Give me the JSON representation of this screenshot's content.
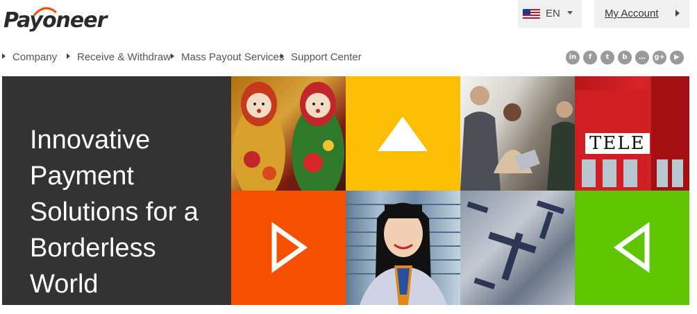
{
  "brand": {
    "name": "Payoneer",
    "accent": "#f54f00"
  },
  "header": {
    "language": {
      "code": "EN",
      "flag_icon": "us-flag-icon"
    },
    "account": {
      "label": "My Account"
    }
  },
  "nav": {
    "items": [
      {
        "label": "Company"
      },
      {
        "label": "Receive & Withdraw"
      },
      {
        "label": "Mass Payout Services"
      },
      {
        "label": "Support Center"
      }
    ]
  },
  "social": {
    "icons": [
      {
        "name": "linkedin-icon",
        "glyph": "in"
      },
      {
        "name": "facebook-icon",
        "glyph": "f"
      },
      {
        "name": "twitter-icon",
        "glyph": "t"
      },
      {
        "name": "blog-icon",
        "glyph": "b"
      },
      {
        "name": "chat-icon",
        "glyph": "…"
      },
      {
        "name": "google-plus-icon",
        "glyph": "g+"
      },
      {
        "name": "youtube-icon",
        "glyph": "▶"
      }
    ]
  },
  "hero": {
    "tagline_lines": [
      "Innovative",
      "Payment",
      "Solutions for a",
      "Borderless World"
    ],
    "colors": {
      "panel": "#333333",
      "yellow": "#fdbf05",
      "orange": "#f54f00",
      "green": "#5fc500"
    },
    "booth_sign": "TELE"
  }
}
